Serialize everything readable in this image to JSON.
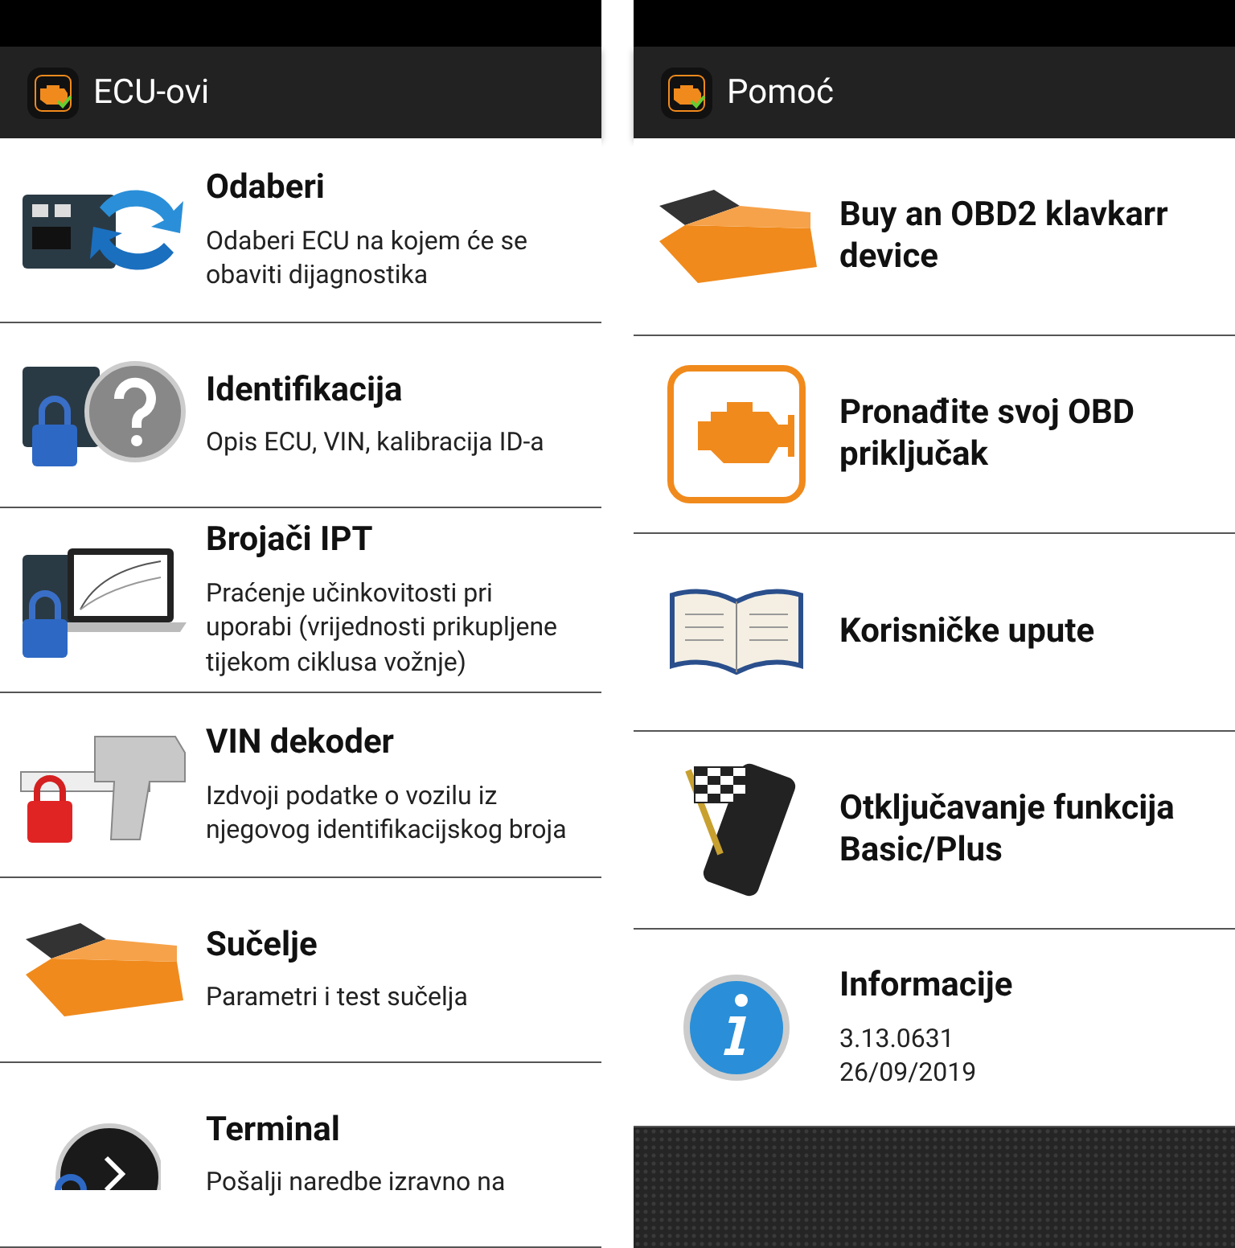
{
  "screens": [
    {
      "title": "ECU-ovi",
      "items": [
        {
          "title": "Odaberi",
          "description": "Odaberi ECU na kojem će se obaviti dijagnostika"
        },
        {
          "title": "Identifikacija",
          "description": "Opis ECU, VIN, kalibracija ID-a"
        },
        {
          "title": "Brojači IPT",
          "description": "Praćenje učinkovitosti pri uporabi (vrijednosti prikupljene tijekom ciklusa vožnje)"
        },
        {
          "title": "VIN dekoder",
          "description": "Izdvoji podatke o vozilu iz njegovog identifikacijskog broja"
        },
        {
          "title": "Sučelje",
          "description": "Parametri i test sučelja"
        },
        {
          "title": "Terminal",
          "description": "Pošalji naredbe izravno na"
        }
      ]
    },
    {
      "title": "Pomoć",
      "items": [
        {
          "title": "Buy an OBD2 klavkarr device"
        },
        {
          "title": "Pronađite svoj OBD priključak"
        },
        {
          "title": "Korisničke upute"
        },
        {
          "title": "Otključavanje funkcija Basic/Plus"
        },
        {
          "title": "Informacije",
          "lines": [
            "3.13.0631",
            "26/09/2019"
          ]
        }
      ]
    }
  ]
}
